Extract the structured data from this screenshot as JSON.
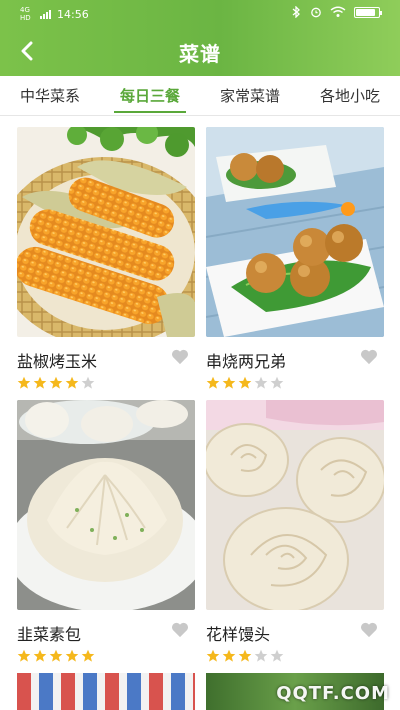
{
  "status_bar": {
    "network": "4G HD",
    "time": "14:56"
  },
  "header": {
    "title": "菜谱"
  },
  "tabs": [
    {
      "label": "中华菜系",
      "active": false
    },
    {
      "label": "每日三餐",
      "active": true
    },
    {
      "label": "家常菜谱",
      "active": false
    },
    {
      "label": "各地小吃",
      "active": false
    }
  ],
  "recipes": [
    {
      "name": "盐椒烤玉米",
      "rating": 4,
      "max_rating": 5,
      "image": "grilled corn"
    },
    {
      "name": "串烧两兄弟",
      "rating": 3,
      "max_rating": 5,
      "image": "skewered balls"
    },
    {
      "name": "韭菜素包",
      "rating": 5,
      "max_rating": 5,
      "image": "steamed buns"
    },
    {
      "name": "花样馒头",
      "rating": 3,
      "max_rating": 5,
      "image": "rose buns"
    }
  ],
  "watermark": "QQTF.COM",
  "colors": {
    "brand_green": "#6bb543",
    "star_gold": "#f5b81c",
    "star_empty": "#cfcfcf",
    "fav_gray": "#c8c8c8"
  }
}
